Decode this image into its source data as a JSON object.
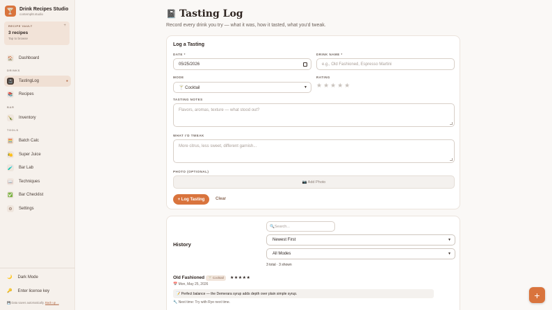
{
  "app": {
    "title": "Drink Recipes Studio",
    "user": "contempl8.studio",
    "logo_icon": "🍸"
  },
  "vault": {
    "label": "RECIPE VAULT",
    "plus": "+",
    "count": "3 recipes",
    "hint": "Tap to browse"
  },
  "nav": {
    "dashboard": {
      "label": "Dashboard",
      "icon": "🏠"
    },
    "drinks_section": "DRINKS",
    "tasting_log": {
      "label": "TastingLog",
      "icon": "📓",
      "dot": "●"
    },
    "recipes": {
      "label": "Recipes",
      "icon": "📚"
    },
    "bar_section": "BAR",
    "inventory": {
      "label": "Inventory",
      "icon": "🍾"
    },
    "tools_section": "TOOLS",
    "batch_calc": {
      "label": "Batch Calc",
      "icon": "🧮"
    },
    "super_juice": {
      "label": "Super Juice",
      "icon": "🍋"
    },
    "bar_lab": {
      "label": "Bar Lab",
      "icon": "🧪"
    },
    "techniques": {
      "label": "Techniques",
      "icon": "📖"
    },
    "bar_checklist": {
      "label": "Bar Checklist",
      "icon": "✅"
    },
    "settings": {
      "label": "Settings",
      "icon": "⚙"
    }
  },
  "footer": {
    "dark_mode": {
      "label": "Dark Mode",
      "icon": "🌙"
    },
    "license": {
      "label": "Enter license key",
      "icon": "🔑"
    },
    "saved_note": "💾 Data saves automatically.",
    "backup_link": "Back up ..."
  },
  "page": {
    "title_icon": "📓",
    "title": "Tasting Log",
    "subtitle": "Record every drink you try — what it was, how it tasted, what you'd tweak."
  },
  "form": {
    "title": "Log a Tasting",
    "date_label": "DATE *",
    "date_value": "05/25/2026",
    "drink_label": "DRINK NAME *",
    "drink_placeholder": "e.g., Old Fashioned, Espresso Martini",
    "mode_label": "MODE",
    "mode_value": "🍸 Cocktail",
    "rating_label": "RATING",
    "rating_stars": "★★★★★",
    "notes_label": "TASTING NOTES",
    "notes_placeholder": "Flavors, aromas, texture — what stood out?",
    "tweak_label": "WHAT I'D TWEAK",
    "tweak_placeholder": "More citrus, less sweet, different garnish...",
    "photo_label": "PHOTO (OPTIONAL)",
    "photo_button": "📷 Add Photo",
    "submit": "+ Log Tasting",
    "clear": "Clear"
  },
  "history": {
    "title": "History",
    "search_placeholder": "Search...",
    "sort_value": "Newest First",
    "filter_value": "All Modes",
    "count": "3 total · 3 shown",
    "entries": [
      {
        "name": "Old Fashioned",
        "mode": "🍸 Cocktail",
        "stars": "★★★★★",
        "date": "📅 Mon, May 25, 2026",
        "note": "📝 Perfect balance — the Demerara syrup adds depth over plain simple syrup.",
        "tweak": "🔧 Next time: Try with Rye next time."
      }
    ]
  },
  "fab": "+",
  "colors": {
    "accent": "#d9743d",
    "sidebar": "#f6f1ec",
    "background": "#faf8f6"
  }
}
